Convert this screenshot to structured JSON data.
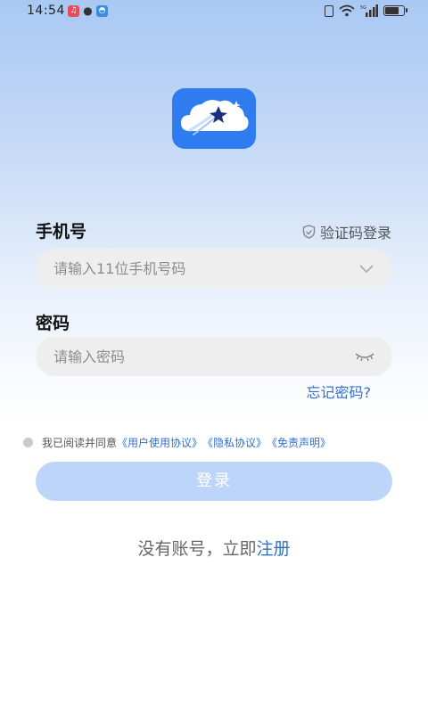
{
  "status_bar": {
    "time": "14:54",
    "app_icons": [
      "music-icon",
      "chat-icon",
      "app-icon"
    ],
    "signal_label": "5G",
    "battery_level": 0.8
  },
  "logo": {
    "icon": "cloud-star-logo-icon"
  },
  "login": {
    "phone_label": "手机号",
    "sms_login": "验证码登录",
    "phone_placeholder": "请输入11位手机号码",
    "password_label": "密码",
    "password_placeholder": "请输入密码",
    "forgot_password": "忘记密码?"
  },
  "agreement": {
    "prefix": "我已阅读并同意",
    "user_agreement": "《用户使用协议》",
    "privacy_policy": "《隐私协议》",
    "disclaimer": "《免责声明》"
  },
  "login_button": "登录",
  "register": {
    "prompt": "没有账号，立即",
    "link": "注册"
  },
  "colors": {
    "accent": "#2f7cf0",
    "link": "#2f6fd0",
    "button_disabled": "#bcd5f8"
  }
}
